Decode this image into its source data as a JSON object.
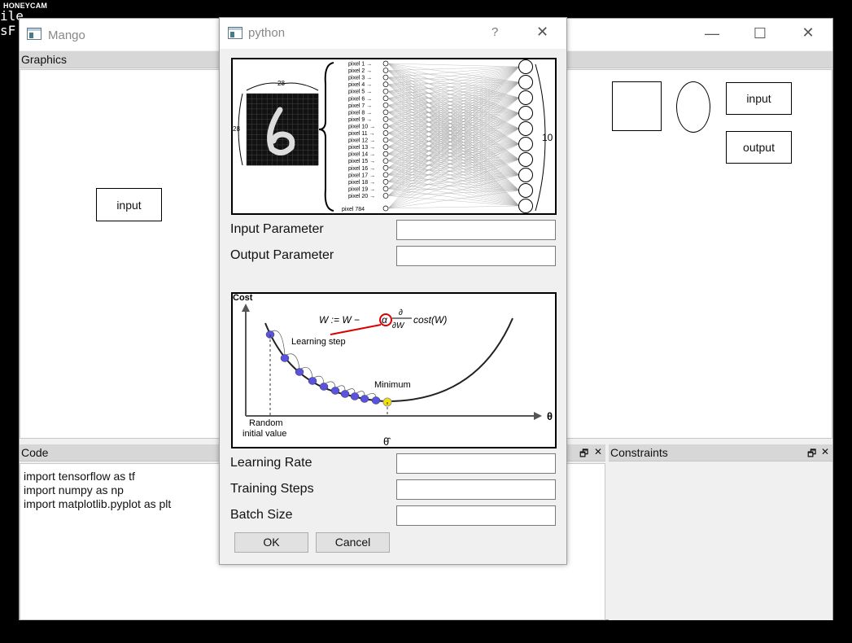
{
  "background": {
    "watermark": "HONEYCAM",
    "line1": "ile",
    "line2": "sF"
  },
  "main_window": {
    "title": "Mango",
    "controls": {
      "minimize": "—",
      "maximize": "☐",
      "close": "✕"
    },
    "graphics_panel": {
      "header": "Graphics",
      "left_node": "input",
      "right_nodes": {
        "input": "input",
        "output": "output"
      }
    },
    "code_panel": {
      "header": "Code",
      "lines": [
        "import tensorflow as tf",
        "import numpy as np",
        "import matplotlib.pyplot as plt"
      ]
    },
    "constraints_panel": {
      "header": "Constraints"
    },
    "dock_buttons": {
      "float": "🗗",
      "close": "✕"
    }
  },
  "dialog": {
    "title": "python",
    "help": "?",
    "close": "✕",
    "network_image": {
      "dim_top": "28",
      "dim_left": "28",
      "pixels": [
        "pixel 1",
        "pixel 2",
        "pixel 3",
        "pixel 4",
        "pixel 5",
        "pixel 6",
        "pixel 7",
        "pixel 8",
        "pixel 9",
        "pixel 10",
        "pixel 11",
        "pixel 12",
        "pixel 13",
        "pixel 14",
        "pixel 15",
        "pixel 16",
        "pixel 17",
        "pixel 18",
        "pixel 19",
        "pixel 20"
      ],
      "pixel_last": "pixel 784",
      "outputs": "10"
    },
    "fields_top": [
      {
        "label": "Input Parameter",
        "value": ""
      },
      {
        "label": "Output Parameter",
        "value": ""
      }
    ],
    "gradient_image": {
      "y_label": "Cost",
      "x_label": "θ",
      "formula_left": "W := W −",
      "alpha": "α",
      "partial_num": "∂",
      "partial_den": "∂W",
      "formula_right": "cost(W)",
      "learning_step": "Learning step",
      "minimum": "Minimum",
      "random1": "Random",
      "random2": "initial value",
      "theta_hat": "θ̂"
    },
    "fields_bottom": [
      {
        "label": "Learning Rate",
        "value": ""
      },
      {
        "label": "Training Steps",
        "value": ""
      },
      {
        "label": "Batch Size",
        "value": ""
      }
    ],
    "ok": "OK",
    "cancel": "Cancel"
  }
}
